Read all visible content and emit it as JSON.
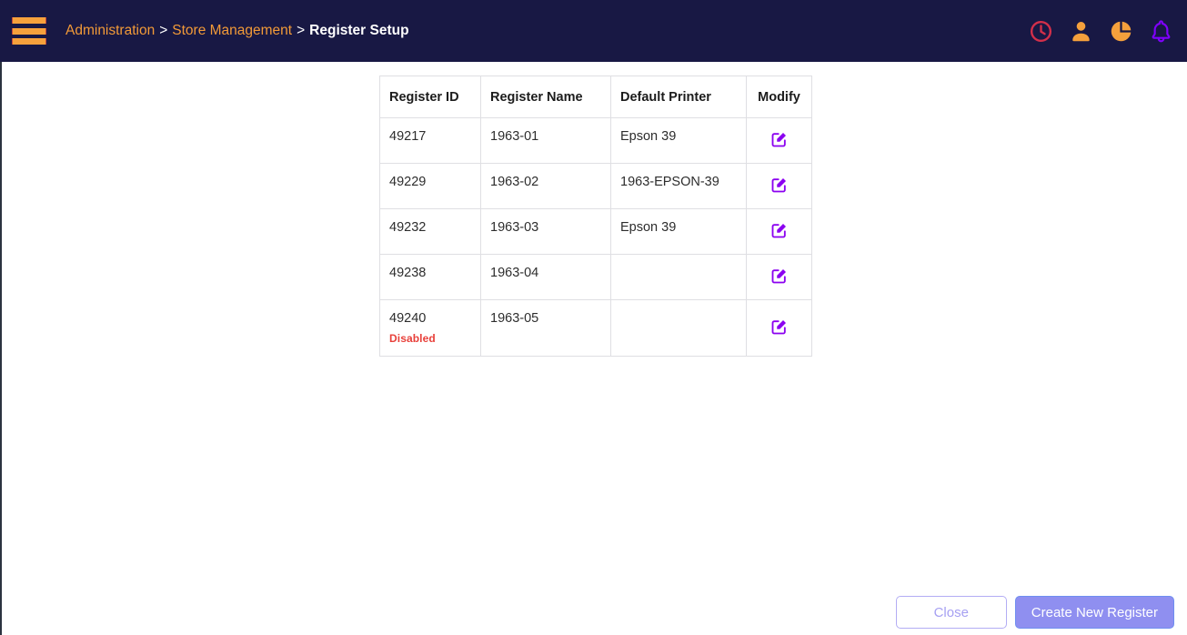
{
  "topbar": {
    "menu_icon": "hamburger-menu-icon",
    "breadcrumb": {
      "items": [
        {
          "label": "Administration",
          "type": "link"
        },
        {
          "label": "Store Management",
          "type": "link"
        },
        {
          "label": "Register Setup",
          "type": "current"
        }
      ],
      "separator": ">"
    },
    "icons": [
      {
        "name": "clock-icon",
        "color": "#d32f4a"
      },
      {
        "name": "user-icon",
        "color": "#f5a03c"
      },
      {
        "name": "pie-chart-icon",
        "color": "#f5a03c"
      },
      {
        "name": "bell-icon",
        "color": "#8000ff"
      }
    ],
    "background_color": "#181844"
  },
  "table": {
    "columns": [
      "Register ID",
      "Register Name",
      "Default Printer",
      "Modify"
    ],
    "rows": [
      {
        "id": "49217",
        "name": "1963-01",
        "printer": "Epson 39",
        "status": "",
        "modify_icon": "edit-pencil-square-icon"
      },
      {
        "id": "49229",
        "name": "1963-02",
        "printer": "1963-EPSON-39",
        "status": "",
        "modify_icon": "edit-pencil-square-icon"
      },
      {
        "id": "49232",
        "name": "1963-03",
        "printer": "Epson 39",
        "status": "",
        "modify_icon": "edit-pencil-square-icon"
      },
      {
        "id": "49238",
        "name": "1963-04",
        "printer": "",
        "status": "",
        "modify_icon": "edit-pencil-square-icon"
      },
      {
        "id": "49240",
        "name": "1963-05",
        "printer": "",
        "status": "Disabled",
        "modify_icon": "edit-pencil-square-icon"
      }
    ]
  },
  "footer": {
    "close_label": "Close",
    "create_label": "Create New Register"
  },
  "colors": {
    "accent_orange": "#f29a38",
    "accent_purple": "#8000ff",
    "button_primary": "#8f8ff0",
    "status_disabled": "#e8403a"
  }
}
